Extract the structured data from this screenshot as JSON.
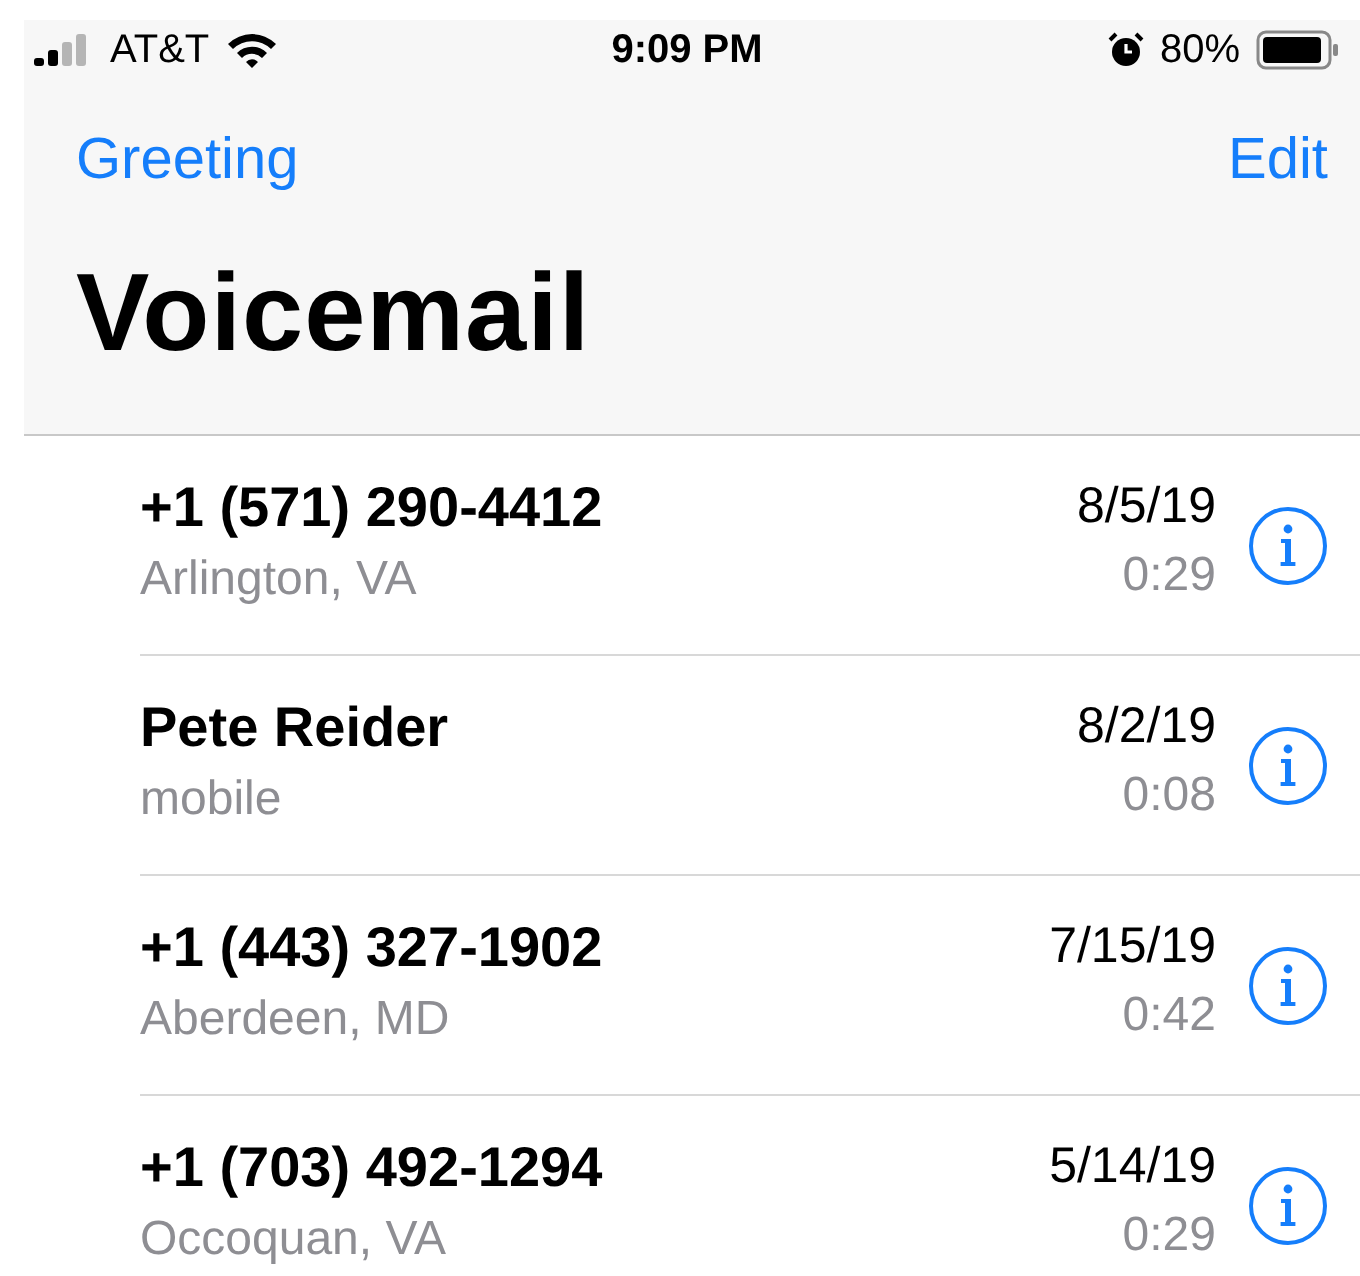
{
  "status_bar": {
    "carrier": "AT&T",
    "time": "9:09 PM",
    "battery": "80%"
  },
  "nav": {
    "left": "Greeting",
    "right": "Edit"
  },
  "title": "Voicemail",
  "voicemails": [
    {
      "caller": "+1 (571) 290-4412",
      "detail": "Arlington, VA",
      "date": "8/5/19",
      "duration": "0:29"
    },
    {
      "caller": "Pete Reider",
      "detail": "mobile",
      "date": "8/2/19",
      "duration": "0:08"
    },
    {
      "caller": "+1 (443) 327-1902",
      "detail": "Aberdeen, MD",
      "date": "7/15/19",
      "duration": "0:42"
    },
    {
      "caller": "+1 (703) 492-1294",
      "detail": "Occoquan, VA",
      "date": "5/14/19",
      "duration": "0:29"
    }
  ]
}
